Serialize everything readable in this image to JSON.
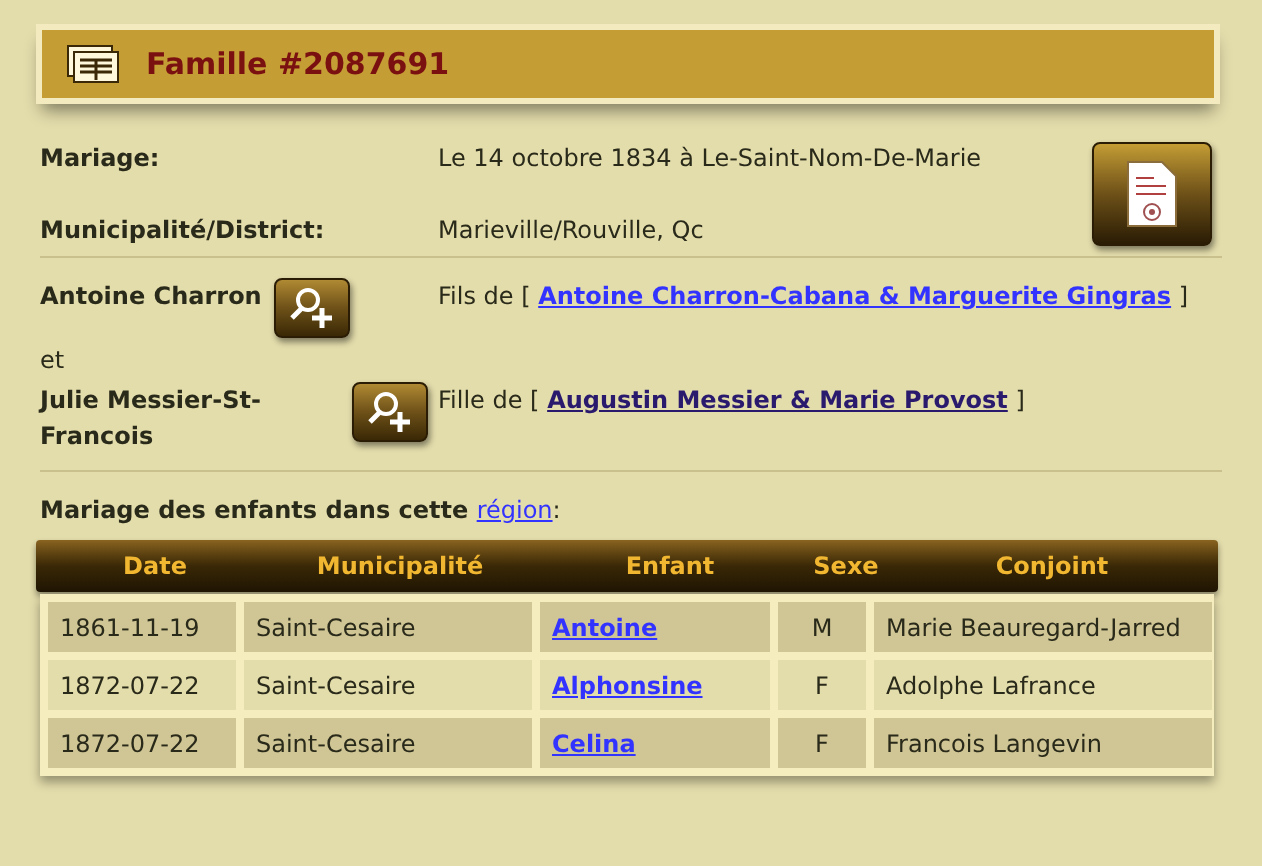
{
  "header": {
    "title": "Famille #2087691"
  },
  "details": [
    {
      "label": "Mariage:",
      "value": "Le 14 octobre 1834 à Le-Saint-Nom-De-Marie"
    },
    {
      "label": "Municipalité/District:",
      "value": "Marieville/Rouville, Qc"
    }
  ],
  "spouses": [
    {
      "name": "Antoine Charron",
      "relation": "Fils de [",
      "parents": "Antoine Charron-Cabana & Marguerite Gingras",
      "visited": false,
      "close": "]"
    },
    {
      "name": "Julie Messier-St-Francois",
      "relation": "Fille de [",
      "parents": "Augustin Messier & Marie Provost",
      "visited": true,
      "close": "]"
    }
  ],
  "conjunction": "et",
  "children_heading": {
    "text": "Mariage des enfants dans cette",
    "link": "région",
    "suffix": ":"
  },
  "table": {
    "columns": [
      "Date",
      "Municipalité",
      "Enfant",
      "Sexe",
      "Conjoint"
    ],
    "rows": [
      [
        "1861-11-19",
        "Saint-Cesaire",
        "Antoine",
        "M",
        "Marie Beauregard-Jarred"
      ],
      [
        "1872-07-22",
        "Saint-Cesaire",
        "Alphonsine",
        "F",
        "Adolphe Lafrance"
      ],
      [
        "1872-07-22",
        "Saint-Cesaire",
        "Celina",
        "F",
        "Francois Langevin"
      ]
    ]
  }
}
